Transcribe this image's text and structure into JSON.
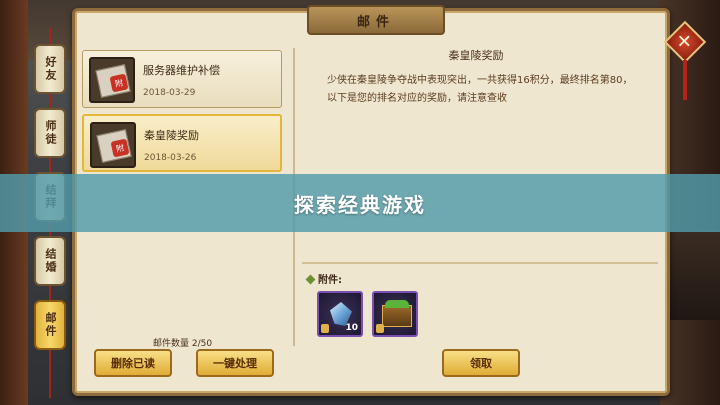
{
  "window": {
    "title": "邮件"
  },
  "tabs": [
    {
      "label": "好友",
      "active": false
    },
    {
      "label": "师徒",
      "active": false
    },
    {
      "label": "结拜",
      "active": false
    },
    {
      "label": "结婚",
      "active": false
    },
    {
      "label": "邮件",
      "active": true
    }
  ],
  "mails": [
    {
      "title": "服务器维护补偿",
      "date": "2018-03-29",
      "selected": false
    },
    {
      "title": "秦皇陵奖励",
      "date": "2018-03-26",
      "selected": true
    }
  ],
  "mail_icon_glyph": "附",
  "detail": {
    "title": "秦皇陵奖励",
    "body": "少侠在秦皇陵争夺战中表现突出，一共获得16积分，最终排名第80，以下是您的排名对应的奖励，请注意查收"
  },
  "attachments": {
    "label": "附件:",
    "items": [
      {
        "icon": "crystal-icon",
        "count": "10"
      },
      {
        "icon": "treasure-chest-icon",
        "count": ""
      }
    ]
  },
  "footer": {
    "mail_count": "邮件数量 2/50",
    "delete_read_label": "删除已读",
    "process_all_label": "一键处理",
    "claim_label": "领取"
  },
  "banner": {
    "text": "探索经典游戏"
  },
  "colors": {
    "accent_gold": "#e4b63a",
    "banner_teal": "#529baa",
    "close_red": "#c73224"
  }
}
